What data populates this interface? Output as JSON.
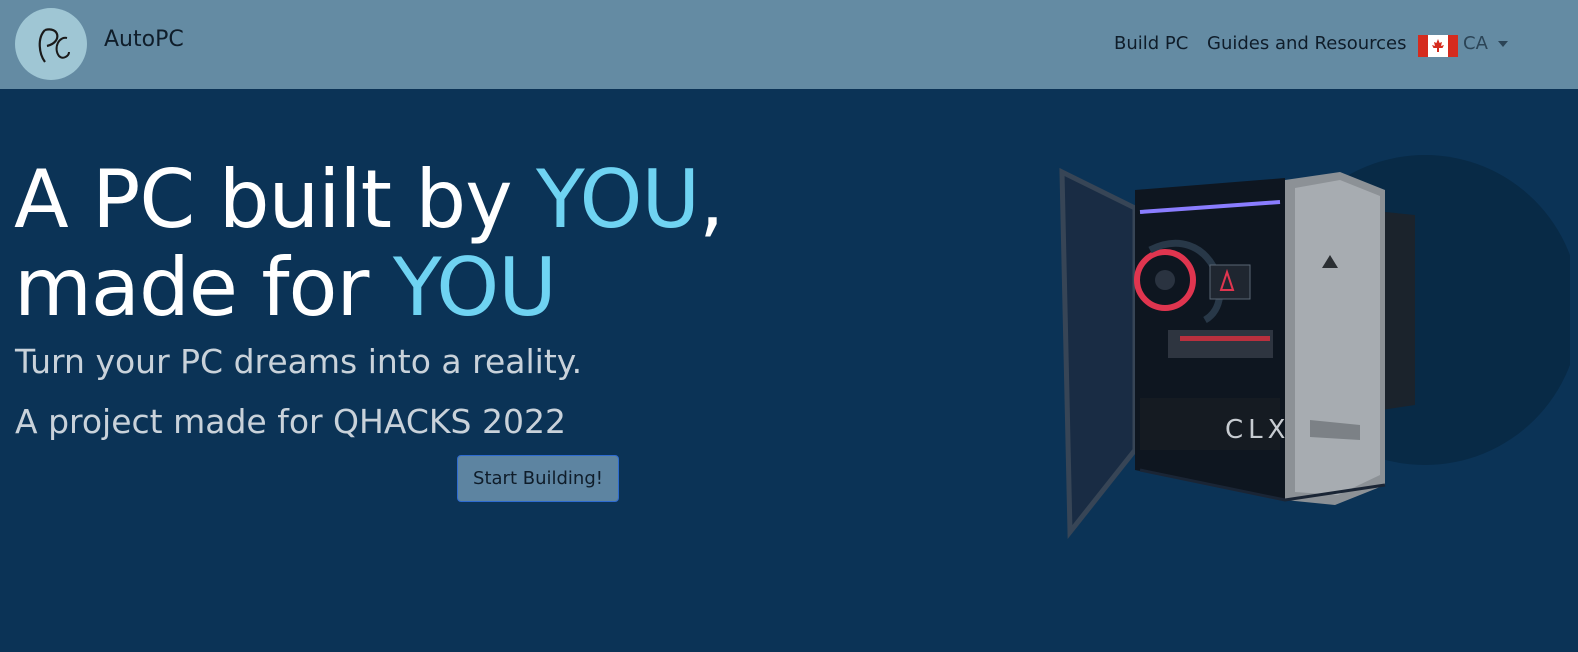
{
  "navbar": {
    "brand": "AutoPC",
    "logo_text": "PC",
    "links": [
      {
        "label": "Build PC"
      },
      {
        "label": "Guides and Resources"
      }
    ],
    "region": {
      "code": "CA",
      "flag_icon": "canada-flag-icon"
    }
  },
  "hero": {
    "line1_pre": "A PC built by ",
    "line1_accent": "YOU",
    "line1_post": ",",
    "line2_pre": "made for ",
    "line2_accent": "YOU",
    "subtitle": "Turn your PC dreams into a reality.",
    "subtitle2": "A project made for QHACKS 2022",
    "cta_label": "Start Building!"
  },
  "image": {
    "case_label": "CLX"
  },
  "colors": {
    "navbar_bg": "#648ba3",
    "page_bg": "#0b3356",
    "accent": "#6fd3f2",
    "button_bg": "#5d84a1"
  }
}
